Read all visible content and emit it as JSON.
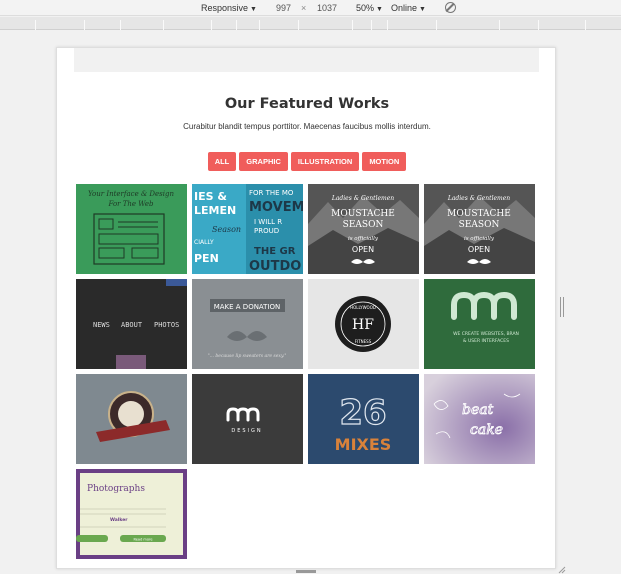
{
  "devtools": {
    "device": "Responsive",
    "width": "997",
    "times": "×",
    "height": "1037",
    "zoom": "50%",
    "network": "Online"
  },
  "page": {
    "title": "Our Featured Works",
    "subtitle": "Curabitur blandit tempus porttitor. Maecenas faucibus mollis interdum."
  },
  "filters": [
    "ALL",
    "GRAPHIC",
    "ILLUSTRATION",
    "MOTION"
  ],
  "colors": {
    "accent": "#f05d5b"
  },
  "tiles": [
    {
      "text": [
        "Your Interface & Design",
        "For The Web"
      ]
    },
    {
      "text": [
        "IES &",
        "LEMEN",
        "FOR THE MO",
        "MOVEM",
        "I WILL R",
        "PROUD",
        "Season",
        "CIALLY",
        "PEN",
        "THE GR",
        "OUTDO"
      ]
    },
    {
      "text": [
        "Ladies & Gentlemen",
        "MOUSTACHE",
        "SEASON",
        "is officially",
        "OPEN"
      ]
    },
    {
      "text": [
        "Ladies & Gentlemen",
        "MOUSTACHE",
        "SEASON",
        "is officially",
        "OPEN"
      ]
    },
    {
      "text": [
        "NEWS",
        "ABOUT",
        "PHOTOS"
      ]
    },
    {
      "text": [
        "MAKE A DONATION",
        "\"... because lip sweaters are sexy.\""
      ]
    },
    {
      "text": [
        "HOLLYWOOD",
        "HF",
        "FITNESS"
      ]
    },
    {
      "text": [
        "WE CREATE WEBSITES, BRAN",
        "& USER INTERFACES"
      ]
    },
    {
      "text": []
    },
    {
      "text": [
        "DESIGN"
      ]
    },
    {
      "text": [
        "26",
        "MIXES"
      ]
    },
    {
      "text": [
        "beat",
        "cake"
      ]
    },
    {
      "text": [
        "Photographs",
        "Walker",
        "Read more"
      ]
    }
  ]
}
